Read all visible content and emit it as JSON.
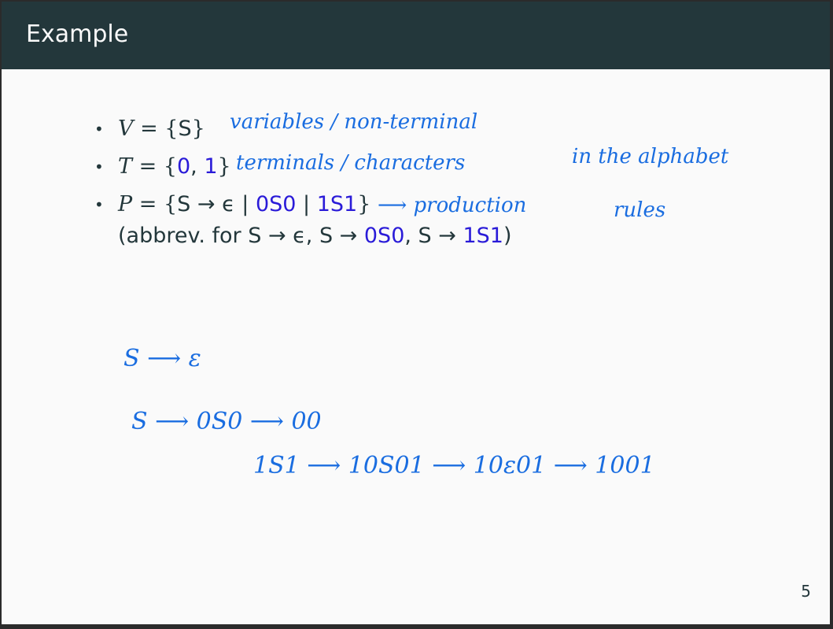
{
  "header": {
    "title": "Example"
  },
  "items": [
    {
      "lhs": "V",
      "eq": " = {",
      "inner": "S",
      "close": "}"
    },
    {
      "lhs": "T",
      "eq": " = {",
      "a": "0",
      ",": ", ",
      "b": "1",
      "close": "}"
    },
    {
      "lhs": "P",
      "eq": " = {",
      "s": "S",
      "arrow": " → ϵ | ",
      "r1": "0S0",
      "bar": " | ",
      "r2": "1S1",
      "close": "}"
    }
  ],
  "abbrev": {
    "open": "(abbrev. for ",
    "p1": "S → ϵ, S → ",
    "r1": "0S0",
    "p2": ", S → ",
    "r2": "1S1",
    "close": ")"
  },
  "annotations": {
    "variables": "variables / non-terminal",
    "terminals": "terminals / characters",
    "alphabet": "in the alphabet",
    "production": "⟶ production",
    "rules": "rules",
    "deriv1": "S ⟶ ε",
    "deriv2": "S ⟶ 0S0 ⟶ 00",
    "deriv3": "1S1 ⟶ 10S01 ⟶ 10ε01 ⟶ 1001"
  },
  "page_number": "5",
  "colors": {
    "header": "#23373b",
    "accent": "#2a1bd8",
    "ink": "#1a6de0"
  }
}
